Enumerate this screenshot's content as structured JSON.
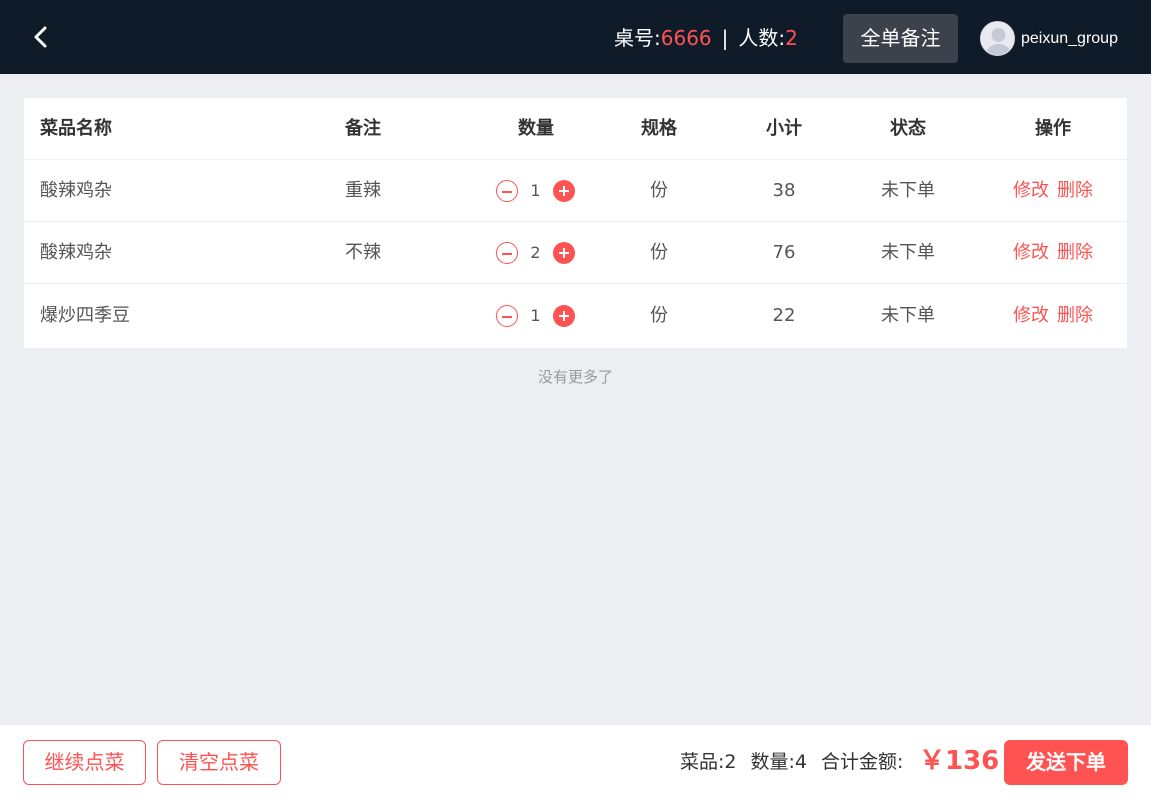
{
  "header": {
    "table_label": "桌号:",
    "table_no": "6666",
    "separator": "|",
    "people_label": "人数:",
    "people_count": "2",
    "note_button": "全单备注",
    "username": "peixun_group"
  },
  "table": {
    "columns": [
      "菜品名称",
      "备注",
      "数量",
      "规格",
      "小计",
      "状态",
      "操作"
    ],
    "rows": [
      {
        "name": "酸辣鸡杂",
        "note": "重辣",
        "qty": "1",
        "spec": "份",
        "subtotal": "38",
        "status": "未下单",
        "edit": "修改",
        "delete": "删除"
      },
      {
        "name": "酸辣鸡杂",
        "note": "不辣",
        "qty": "2",
        "spec": "份",
        "subtotal": "76",
        "status": "未下单",
        "edit": "修改",
        "delete": "删除"
      },
      {
        "name": "爆炒四季豆",
        "note": "",
        "qty": "1",
        "spec": "份",
        "subtotal": "22",
        "status": "未下单",
        "edit": "修改",
        "delete": "删除"
      }
    ],
    "no_more": "没有更多了"
  },
  "footer": {
    "continue_button": "继续点菜",
    "clear_button": "清空点菜",
    "dish_count": "菜品:2",
    "quantity": "数量:4",
    "total_label": "合计金额:",
    "total_price": "￥136",
    "submit_button": "发送下单"
  },
  "colors": {
    "header_bg": "#101b29",
    "accent": "#ff5252",
    "page_bg": "#edeef2"
  },
  "icons": [
    "back-arrow-icon",
    "avatar-icon",
    "minus-icon",
    "plus-icon"
  ]
}
